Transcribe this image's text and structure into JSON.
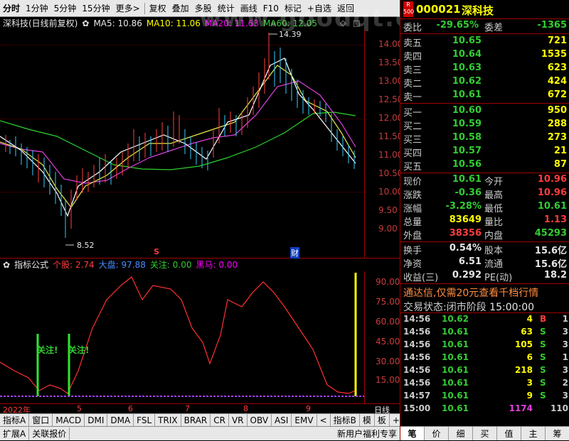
{
  "toolbar": {
    "logo": "分时",
    "periods": [
      "1分钟",
      "5分钟",
      "15分钟",
      "更多>"
    ],
    "actions": [
      "复权",
      "叠加",
      "多股",
      "统计",
      "画线",
      "F10",
      "标记",
      "+自选",
      "返回"
    ]
  },
  "chart_title": {
    "name": "深科技(日线前复权)",
    "ma5": "MA5: 10.86",
    "ma10": "MA10: 11.06",
    "ma20": "MA20: 11.63",
    "ma60": "MA60: 12.05"
  },
  "price_axis": [
    "14.00",
    "13.50",
    "13.00",
    "12.50",
    "12.00",
    "11.50",
    "11.00",
    "10.50",
    "10.00",
    "9.50",
    "9.00"
  ],
  "annotations": {
    "high": "14.39",
    "low": "8.52",
    "marker_s": "S",
    "marker_cai": "财"
  },
  "indicator": {
    "name": "指标公式",
    "a_label": "个股:",
    "a_val": "2.74",
    "b_label": "大盘:",
    "b_val": "97.88",
    "c_label": "关注:",
    "c_val": "0.00",
    "d_label": "黑马:",
    "d_val": "0.00",
    "axis": [
      "90.00",
      "75.00",
      "60.00",
      "45.00",
      "30.00",
      "15.00"
    ],
    "attention_label": "关注!"
  },
  "date_axis": [
    "2022年",
    "5",
    "6",
    "7",
    "8",
    "9"
  ],
  "date_axis_right": "日线",
  "indicator_tabs": [
    "指标A",
    "窗口",
    "MACD",
    "DMI",
    "DMA",
    "FSL",
    "TRIX",
    "BRAR",
    "CR",
    "VR",
    "OBV",
    "ASI",
    "EMV",
    "指标B",
    "模",
    "板",
    "+",
    "-"
  ],
  "status_bar": [
    "扩展A",
    "关联报价"
  ],
  "status_right": "新用户福利专享",
  "quote": {
    "r_badge": "R",
    "r_sub": "500",
    "code": "000021",
    "name": "深科技",
    "wb_label": "委比",
    "wb_val": "-29.65%",
    "wc_label": "委差",
    "wc_val": "-1365",
    "asks": [
      {
        "label": "卖五",
        "price": "10.65",
        "vol": "721"
      },
      {
        "label": "卖四",
        "price": "10.64",
        "vol": "1535"
      },
      {
        "label": "卖三",
        "price": "10.63",
        "vol": "623"
      },
      {
        "label": "卖二",
        "price": "10.62",
        "vol": "424"
      },
      {
        "label": "卖一",
        "price": "10.61",
        "vol": "672"
      }
    ],
    "bids": [
      {
        "label": "买一",
        "price": "10.60",
        "vol": "950"
      },
      {
        "label": "买二",
        "price": "10.59",
        "vol": "288"
      },
      {
        "label": "买三",
        "price": "10.58",
        "vol": "273"
      },
      {
        "label": "买四",
        "price": "10.57",
        "vol": "21"
      },
      {
        "label": "买五",
        "price": "10.56",
        "vol": "87"
      }
    ],
    "stats": [
      {
        "l": "现价",
        "v": "10.61",
        "l2": "今开",
        "v2": "10.96"
      },
      {
        "l": "涨跌",
        "v": "-0.36",
        "l2": "最高",
        "v2": "10.96"
      },
      {
        "l": "涨幅",
        "v": "-3.28%",
        "l2": "最低",
        "v2": "10.61"
      },
      {
        "l": "总量",
        "v": "83649",
        "l2": "量比",
        "v2": "1.13"
      },
      {
        "l": "外盘",
        "v": "38356",
        "l2": "内盘",
        "v2": "45293"
      }
    ],
    "stats2": [
      {
        "l": "换手",
        "v": "0.54%",
        "l2": "股本",
        "v2": "15.6亿"
      },
      {
        "l": "净资",
        "v": "6.51",
        "l2": "流通",
        "v2": "15.6亿"
      },
      {
        "l": "收益(三)",
        "v": "0.292",
        "l2": "PE(动)",
        "v2": "18.2"
      }
    ],
    "promo": "通达信,仅需20元查看千档行情",
    "trade_status_label": "交易状态:",
    "trade_status": "闭市阶段",
    "trade_time": "15:00:00",
    "ticks": [
      {
        "t": "14:56",
        "p": "10.62",
        "q": "4",
        "s": "B",
        "n": "1"
      },
      {
        "t": "14:56",
        "p": "10.61",
        "q": "63",
        "s": "S",
        "n": "3"
      },
      {
        "t": "14:56",
        "p": "10.61",
        "q": "105",
        "s": "S",
        "n": "3"
      },
      {
        "t": "14:56",
        "p": "10.61",
        "q": "6",
        "s": "S",
        "n": "1"
      },
      {
        "t": "14:56",
        "p": "10.61",
        "q": "218",
        "s": "S",
        "n": "3"
      },
      {
        "t": "14:56",
        "p": "10.61",
        "q": "3",
        "s": "S",
        "n": "2"
      },
      {
        "t": "14:57",
        "p": "10.61",
        "q": "9",
        "s": "S",
        "n": "3"
      },
      {
        "t": "15:00",
        "p": "10.61",
        "q": "1174",
        "s": "",
        "n": "110"
      }
    ],
    "right_tabs": [
      "笔",
      "价",
      "细",
      "买",
      "值",
      "主",
      "筹"
    ]
  },
  "watermark": "www.goodqt.cn"
}
